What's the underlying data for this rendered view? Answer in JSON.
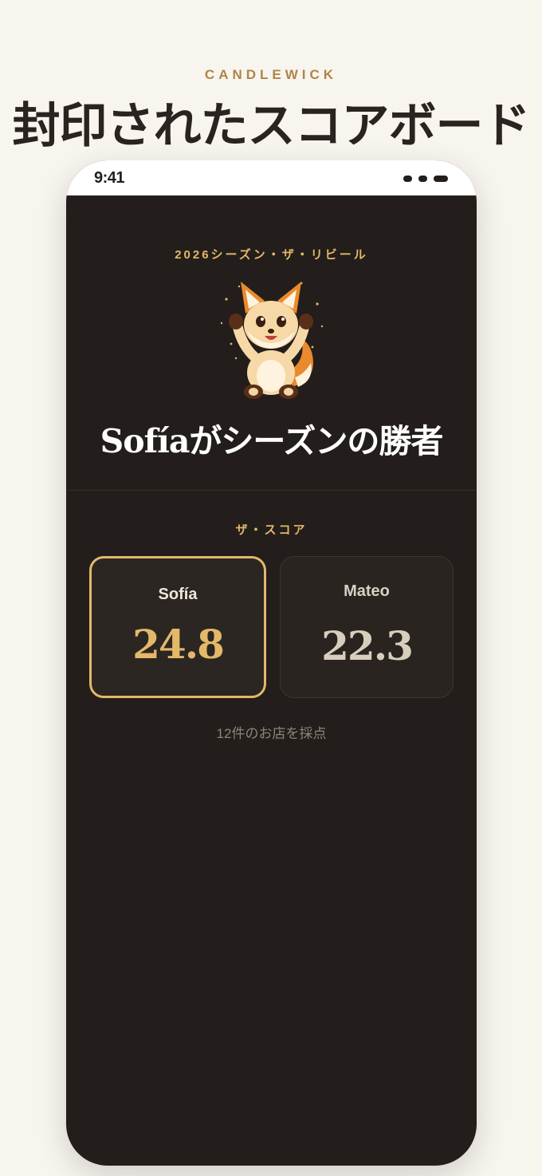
{
  "brand": "CANDLEWICK",
  "page_title": "封印されたスコアボード",
  "status_bar": {
    "time": "9:41"
  },
  "hero": {
    "season_label": "2026シーズン・ザ・リビール",
    "mascot_icon": "fox-mascot-icon",
    "headline": "Sofíaがシーズンの勝者"
  },
  "scores": {
    "label": "ザ・スコア",
    "players": [
      {
        "name": "Sofía",
        "score": "24.8",
        "winner": true
      },
      {
        "name": "Mateo",
        "score": "22.3",
        "winner": false
      }
    ],
    "note": "12件のお店を採点"
  },
  "colors": {
    "page_bg": "#f8f5ef",
    "phone_bg": "#231e1b",
    "accent_gold": "#e3b869",
    "brand_gold": "#b08446",
    "title_dark": "#2a2420"
  }
}
